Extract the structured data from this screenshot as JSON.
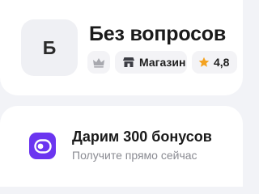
{
  "store": {
    "avatar_letter": "Б",
    "name": "Без вопросов",
    "badges": {
      "crown_icon": "crown-icon",
      "shop_icon": "shop-icon",
      "shop_label": "Магазин",
      "rating_icon": "star-icon",
      "rating_value": "4,8"
    }
  },
  "promo": {
    "icon": "bonus-icon",
    "title": "Дарим 300 бонусов",
    "subtitle": "Получите прямо сейчас"
  },
  "colors": {
    "background": "#f2f3f7",
    "card": "#ffffff",
    "chip": "#f3f3f6",
    "promo_icon": "#6b35f0",
    "star": "#f4a21f",
    "muted_text": "#8a8b92"
  }
}
